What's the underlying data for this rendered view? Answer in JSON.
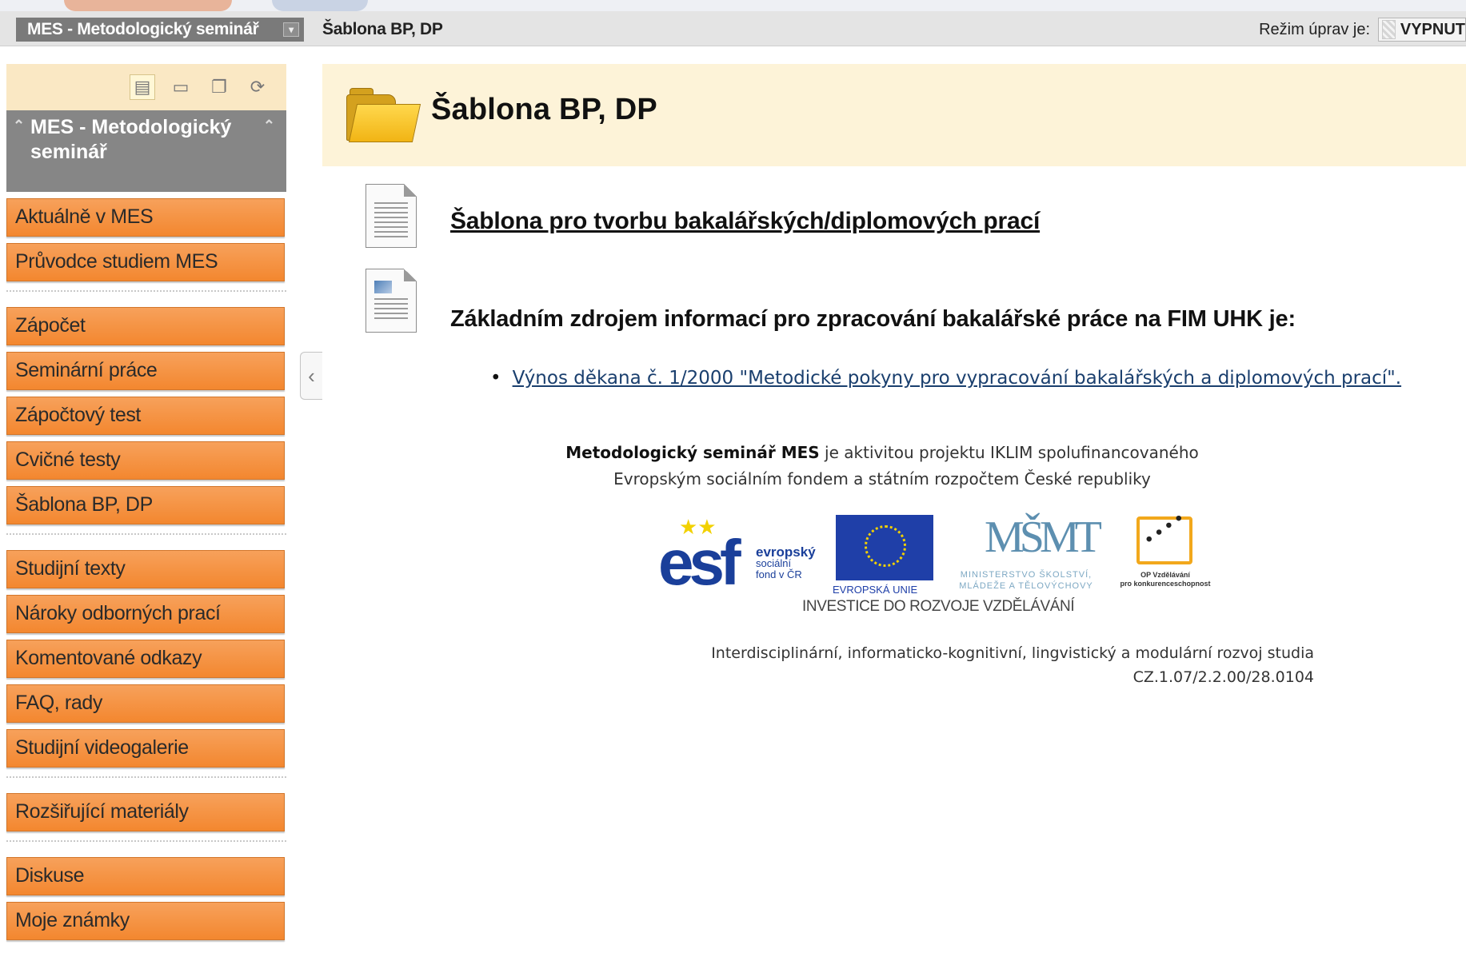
{
  "header": {
    "course_select": "MES - Metodologický seminář",
    "breadcrumb": "Šablona BP, DP",
    "edit_mode_label": "Režim úprav je:",
    "edit_mode_value": "VYPNUT"
  },
  "sidebar": {
    "title": "MES - Metodologický seminář",
    "tools": [
      "list-view-icon",
      "folder-view-icon",
      "window-icon",
      "refresh-icon"
    ],
    "items": [
      "Aktuálně v MES",
      "Průvodce studiem MES",
      "Zápočet",
      "Seminární práce",
      "Zápočtový test",
      "Cvičné testy",
      "Šablona BP, DP",
      "Studijní texty",
      "Nároky odborných prací",
      "Komentované odkazy",
      "FAQ, rady",
      "Studijní videogalerie",
      "Rozšiřující materiály",
      "Diskuse",
      "Moje známky"
    ]
  },
  "main": {
    "title": "Šablona BP, DP",
    "item1_link": "Šablona pro tvorbu bakalářských/diplomových prací",
    "item2_heading": "Základním zdrojem informací pro zpracování bakalářské práce na FIM UHK je:",
    "item2_bullet_link": "Výnos děkana č. 1/2000 \"Metodické pokyny pro vypracování bakalářských a diplomových prací\".",
    "credit": {
      "bold": "Metodologický seminář MES",
      "rest1": " je aktivitou projektu IKLIM spolufinancovaného",
      "line2": "Evropským sociálním fondem a státním rozpočtem České republiky"
    },
    "logos": {
      "esf_text": "esf",
      "esf_line1": "evropský",
      "esf_line2": "sociální",
      "esf_line3": "fond v ČR",
      "eu_label": "EVROPSKÁ UNIE",
      "msmt_mark": "MŠMT",
      "msmt_line1": "MINISTERSTVO ŠKOLSTVÍ,",
      "msmt_line2": "MLÁDEŽE A TĚLOVÝCHOVY",
      "op_line1": "OP Vzdělávání",
      "op_line2": "pro konkurenceschopnost"
    },
    "investice": "INVESTICE DO ROZVOJE VZDĚLÁVÁNÍ",
    "project_name": "Interdisciplinární, informaticko-kognitivní, lingvistický a modulární rozvoj studia",
    "project_code": "CZ.1.07/2.2.00/28.0104"
  },
  "colors": {
    "nav_orange": "#f3872f",
    "banner_bg": "#fdf3d8",
    "tools_bg": "#fae8c4",
    "sidebar_title_bg": "#868686",
    "link_blue": "#1a3f6e"
  }
}
